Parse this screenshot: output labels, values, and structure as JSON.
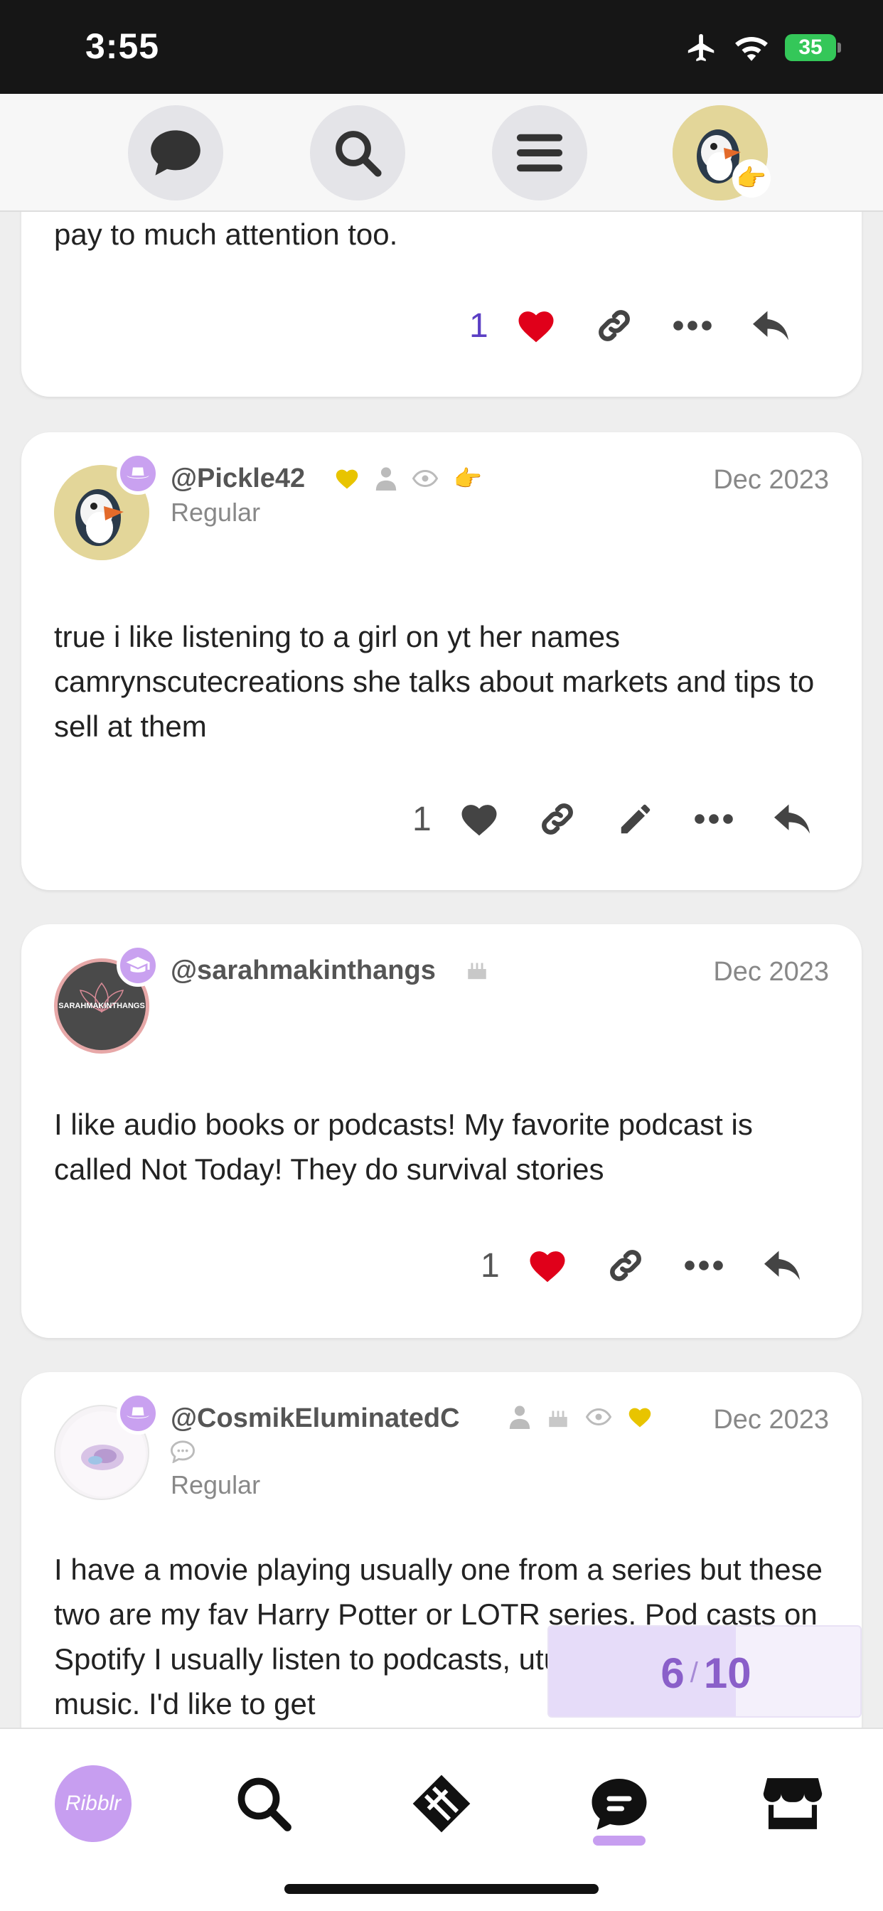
{
  "status_bar": {
    "time": "3:55",
    "battery": "35"
  },
  "top_nav": {
    "badge_emoji": "👉"
  },
  "post0": {
    "text": "pay to much attention too.",
    "like_count": "1"
  },
  "post1": {
    "username": "@Pickle42",
    "title": "Regular",
    "date": "Dec 2023",
    "text": "true i like listening to a girl on yt her names camrynscutecreations she talks about markets and tips to sell at them",
    "like_count": "1",
    "emoji": "👉"
  },
  "post2": {
    "username": "@sarahmakinthangs",
    "avatar_text": "SARAHMAKINTHANGS",
    "date": "Dec 2023",
    "text": "I like audio books or podcasts! My favorite podcast is called Not Today! They do survival stories",
    "like_count": "1"
  },
  "post3": {
    "username": "@CosmikEluminatedC",
    "title": "Regular",
    "date": "Dec 2023",
    "text": "I have a movie playing usually one from a series but these two are my fav Harry Potter or LOTR series. Pod casts on Spotify I usually listen to podcasts, utube audiobooks or music. I'd like to get"
  },
  "progress": {
    "current": "6",
    "separator": "/",
    "total": "10",
    "fraction": 0.6
  },
  "bottom_bar": {
    "logo_label": "Ribblr"
  },
  "colors": {
    "accent": "#c79ef0",
    "heart_red": "#e0001a",
    "count_purple": "#5b3fc4"
  }
}
